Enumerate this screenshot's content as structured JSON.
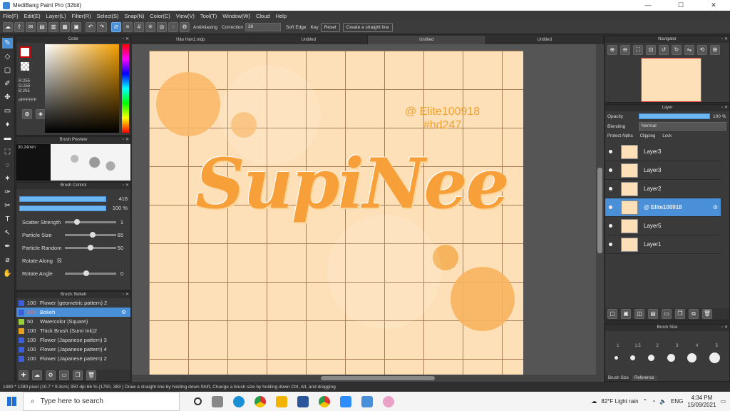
{
  "window": {
    "title": "MediBang Paint Pro (32bit)",
    "minimize": "—",
    "maximize": "☐",
    "close": "✕"
  },
  "menu": [
    "File(F)",
    "Edit(E)",
    "Layer(L)",
    "Filter(R)",
    "Select(S)",
    "Snap(N)",
    "Color(C)",
    "View(V)",
    "Tool(T)",
    "Window(W)",
    "Cloud",
    "Help"
  ],
  "toolbar": {
    "antialiasing": "AntiAliasing",
    "correction_label": "Correction",
    "correction_value": "36",
    "soft_edge": "Soft Edge",
    "key_label": "Key",
    "reset": "Reset",
    "straight_line": "Create a straight line"
  },
  "color_panel": {
    "header": "Color",
    "r": "R:255",
    "g": "G:255",
    "b": "B:255",
    "hex": "#FFFFFF"
  },
  "brush_preview": {
    "header": "Brush Preview",
    "size": "30.24mm"
  },
  "brush_control": {
    "header": "Brush Control",
    "size_value": "416",
    "opacity_value": "100 %",
    "props": [
      {
        "label": "Scatter Strength",
        "value": "1",
        "pos": 0.2
      },
      {
        "label": "Particle Size",
        "value": "65",
        "pos": 0.55
      },
      {
        "label": "Particle Random",
        "value": "50",
        "pos": 0.5
      },
      {
        "label": "Rotate Along",
        "value": "",
        "pos": -1
      },
      {
        "label": "Rotate Angle",
        "value": "0",
        "pos": 0.4
      }
    ]
  },
  "brush_list": {
    "header": "Brush: Bokeh",
    "items": [
      {
        "num": "100",
        "name": "Flower (geometric pattern) 2",
        "color": "#3a5fd8"
      },
      {
        "num": "416",
        "name": "Bokeh",
        "color": "#3a5fd8",
        "active": true
      },
      {
        "num": "50",
        "name": "Watercolor (Square)",
        "color": "#9ad03a"
      },
      {
        "num": "100",
        "name": "Thick Brush (Sumi Ink)2",
        "color": "#e8a020"
      },
      {
        "num": "100",
        "name": "Flower (Japanese pattern) 3",
        "color": "#3a5fd8"
      },
      {
        "num": "100",
        "name": "Flower (Japanese pattern) 4",
        "color": "#3a5fd8"
      },
      {
        "num": "100",
        "name": "Flower (Japanese pattern) 2",
        "color": "#3a5fd8"
      }
    ]
  },
  "tabs": [
    "Hảo Hán1.mdp",
    "Untitled",
    "Untitled",
    "Untitled"
  ],
  "canvas": {
    "watermark_line1": "@ Elite100918",
    "watermark_line2": "#hd247",
    "title_text": "SupiNee"
  },
  "navigator": {
    "header": "Navigator"
  },
  "layer_panel": {
    "header": "Layer",
    "opacity_label": "Opacity",
    "opacity_value": "100 %",
    "blending_label": "Blending",
    "blending_value": "Normal",
    "protect_alpha": "Protect Alpha",
    "clipping": "Clipping",
    "lock": "Lock",
    "layers": [
      {
        "name": "Layer3",
        "active": false
      },
      {
        "name": "Layer3",
        "active": false
      },
      {
        "name": "Layer2",
        "active": false
      },
      {
        "name": "@ Elite100918",
        "active": true
      },
      {
        "name": "Layer5",
        "active": false
      },
      {
        "name": "Layer1",
        "active": false
      }
    ]
  },
  "brush_size": {
    "header": "Brush Size",
    "labels": [
      "1",
      "1.5",
      "2",
      "3",
      "4",
      "5"
    ],
    "tab1": "Brush Size",
    "tab2": "Reference"
  },
  "status": "1480 * 1280 pixel (10.7 * 9.3cm) 350 dpi 66 % (1750, 383 ) Draw a straight line by holding down Shift, Change a brush size by holding down Ctrl, Alt, and dragging",
  "taskbar": {
    "search_placeholder": "Type here to search",
    "weather": "82°F Light rain",
    "lang": "ENG",
    "time": "4:34 PM",
    "date": "15/09/2021"
  },
  "colors": {
    "accent": "#4a90d9",
    "canvas_bg": "#fde0b8",
    "text_orange": "#f0a030"
  }
}
